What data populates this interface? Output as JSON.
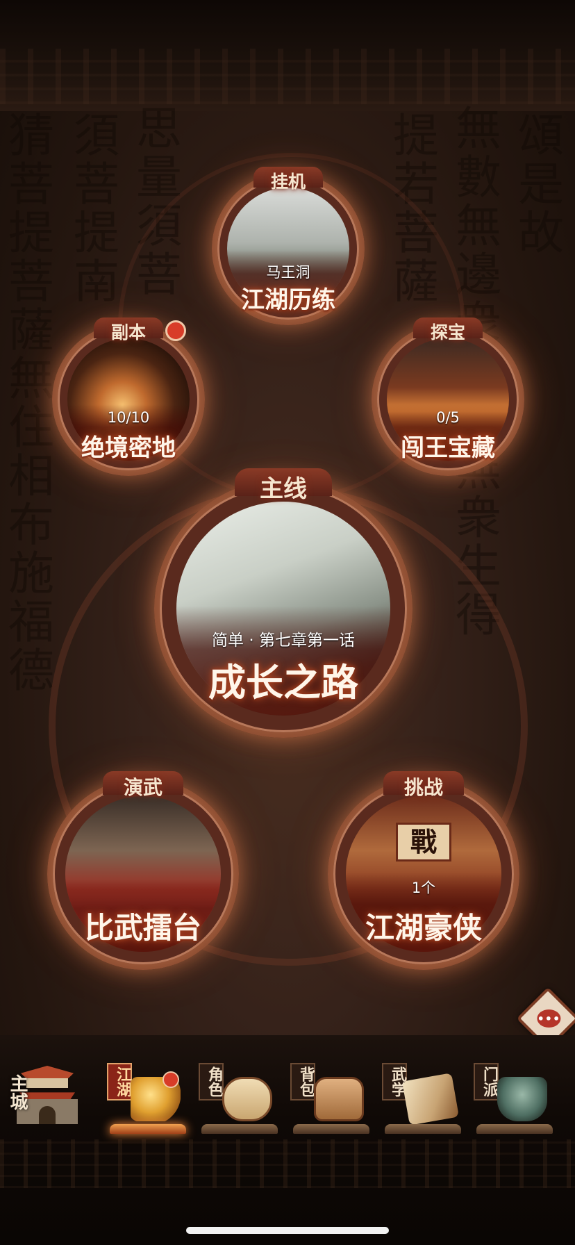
{
  "nodes": {
    "afk": {
      "tag": "挂机",
      "subtitle": "马王洞",
      "title": "江湖历练"
    },
    "dungeon": {
      "tag": "副本",
      "subtitle": "10/10",
      "title": "绝境密地",
      "has_badge": true
    },
    "treasure": {
      "tag": "探宝",
      "subtitle": "0/5",
      "title": "闯王宝藏"
    },
    "main": {
      "tag": "主线",
      "subtitle": "简单 · 第七章第一话",
      "title": "成长之路"
    },
    "arena": {
      "tag": "演武",
      "title": "比武擂台"
    },
    "challenge": {
      "tag": "挑战",
      "subtitle": "1个",
      "title": "江湖豪侠",
      "plaque": "戰"
    }
  },
  "chat": {
    "icon": "chat-bubble-icon",
    "glyph": "•••"
  },
  "nav": {
    "items": [
      {
        "label": "主城",
        "icon": "city-gate-icon",
        "active": false
      },
      {
        "label": "江湖",
        "icon": "golden-sword-icon",
        "active": true,
        "has_badge": true
      },
      {
        "label": "角色",
        "icon": "scroll-icon",
        "active": false
      },
      {
        "label": "背包",
        "icon": "bag-icon",
        "active": false
      },
      {
        "label": "武学",
        "icon": "martial-scroll-icon",
        "active": false
      },
      {
        "label": "门派",
        "icon": "cauldron-icon",
        "active": false
      }
    ]
  },
  "colors": {
    "accent_red": "#d83c28",
    "frame_copper": "#b26a45",
    "title_glow": "#c5562a",
    "background": "#24160f"
  }
}
